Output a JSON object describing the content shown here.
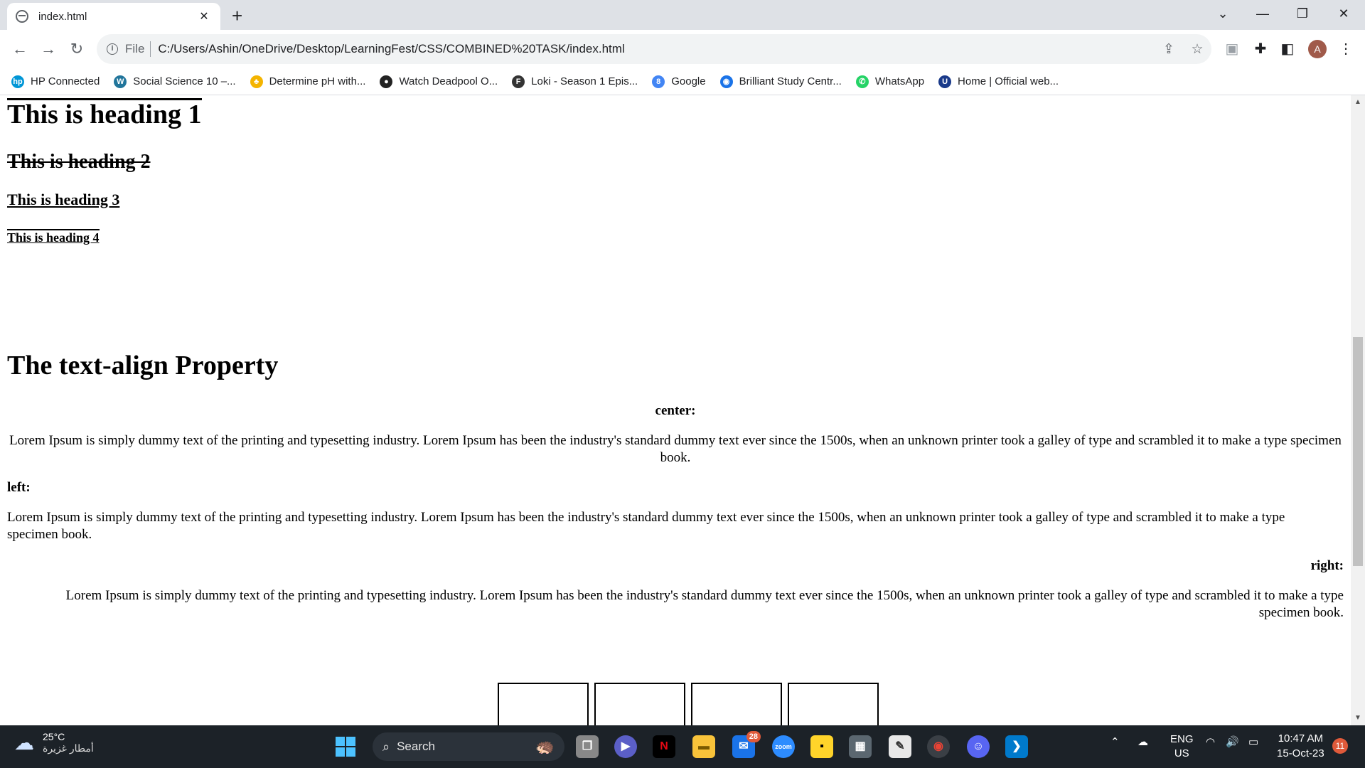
{
  "browser": {
    "tab_title": "index.html",
    "tab_close": "✕",
    "new_tab": "+",
    "scheme": "File",
    "url": "C:/Users/Ashin/OneDrive/Desktop/LearningFest/CSS/COMBINED%20TASK/index.html",
    "avatar_letter": "A"
  },
  "bookmarks": [
    {
      "label": "HP Connected",
      "color": "#0096d6",
      "glyph": "hp"
    },
    {
      "label": "Social Science 10 –...",
      "color": "#21759b",
      "glyph": "W"
    },
    {
      "label": "Determine pH with...",
      "color": "#f4b400",
      "glyph": "♣"
    },
    {
      "label": "Watch Deadpool O...",
      "color": "#222222",
      "glyph": "●"
    },
    {
      "label": "Loki - Season 1 Epis...",
      "color": "#333333",
      "glyph": "F"
    },
    {
      "label": "Google",
      "color": "#4285f4",
      "glyph": "8"
    },
    {
      "label": "Brilliant Study Centr...",
      "color": "#1a73e8",
      "glyph": "◉"
    },
    {
      "label": "WhatsApp",
      "color": "#25d366",
      "glyph": "✆"
    },
    {
      "label": "Home | Official web...",
      "color": "#1a3a8a",
      "glyph": "U"
    }
  ],
  "page": {
    "heading1": "This is heading 1",
    "heading2": "This is heading 2",
    "heading3": "This is heading 3",
    "heading4": "This is heading 4",
    "align_title": "The text-align Property",
    "center_label": "center:",
    "left_label": "left:",
    "right_label": "right:",
    "lorem": "Lorem Ipsum is simply dummy text of the printing and typesetting industry. Lorem Ipsum has been the industry's standard dummy text ever since the 1500s, when an unknown printer took a galley of type and scrambled it to make a type specimen book."
  },
  "taskbar": {
    "temperature": "25°C",
    "weather_desc": "أمطار غزيرة",
    "search_label": "Search",
    "mail_badge": "28",
    "lang_top": "ENG",
    "lang_bottom": "US",
    "time": "10:47 AM",
    "date": "15-Oct-23",
    "notifications": "11"
  },
  "colors": {
    "tab_strip": "#dee1e6",
    "taskbar": "#1c2228",
    "accent_start": "#4cc2ff"
  }
}
